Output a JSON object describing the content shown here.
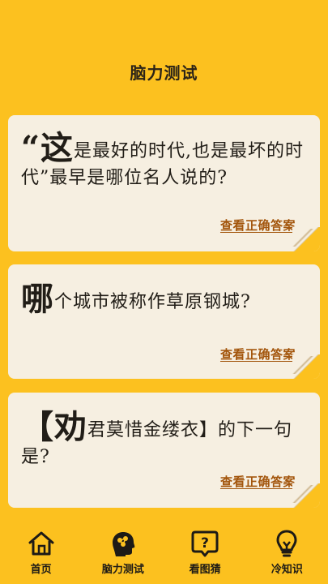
{
  "header": {
    "title": "脑力测试"
  },
  "cards": [
    {
      "lead": "“这",
      "text": "是最好的时代,也是最坏的时代”最早是哪位名人说的?",
      "link": "查看正确答案"
    },
    {
      "lead": "哪",
      "text": "个城市被称作草原钢城?",
      "link": "查看正确答案"
    },
    {
      "lead": "【劝",
      "text": "君莫惜金缕衣】的下一句是?",
      "link": "查看正确答案"
    }
  ],
  "tabbar": {
    "items": [
      {
        "label": "首页",
        "icon": "home-icon"
      },
      {
        "label": "脑力测试",
        "icon": "brain-head-icon",
        "active": true
      },
      {
        "label": "看图猜",
        "icon": "question-bubble-icon"
      },
      {
        "label": "冷知识",
        "icon": "lightbulb-icon"
      }
    ]
  },
  "colors": {
    "primary": "#fcc11f",
    "card": "#f6efe1",
    "link": "#a3560d",
    "text": "#211d17"
  }
}
